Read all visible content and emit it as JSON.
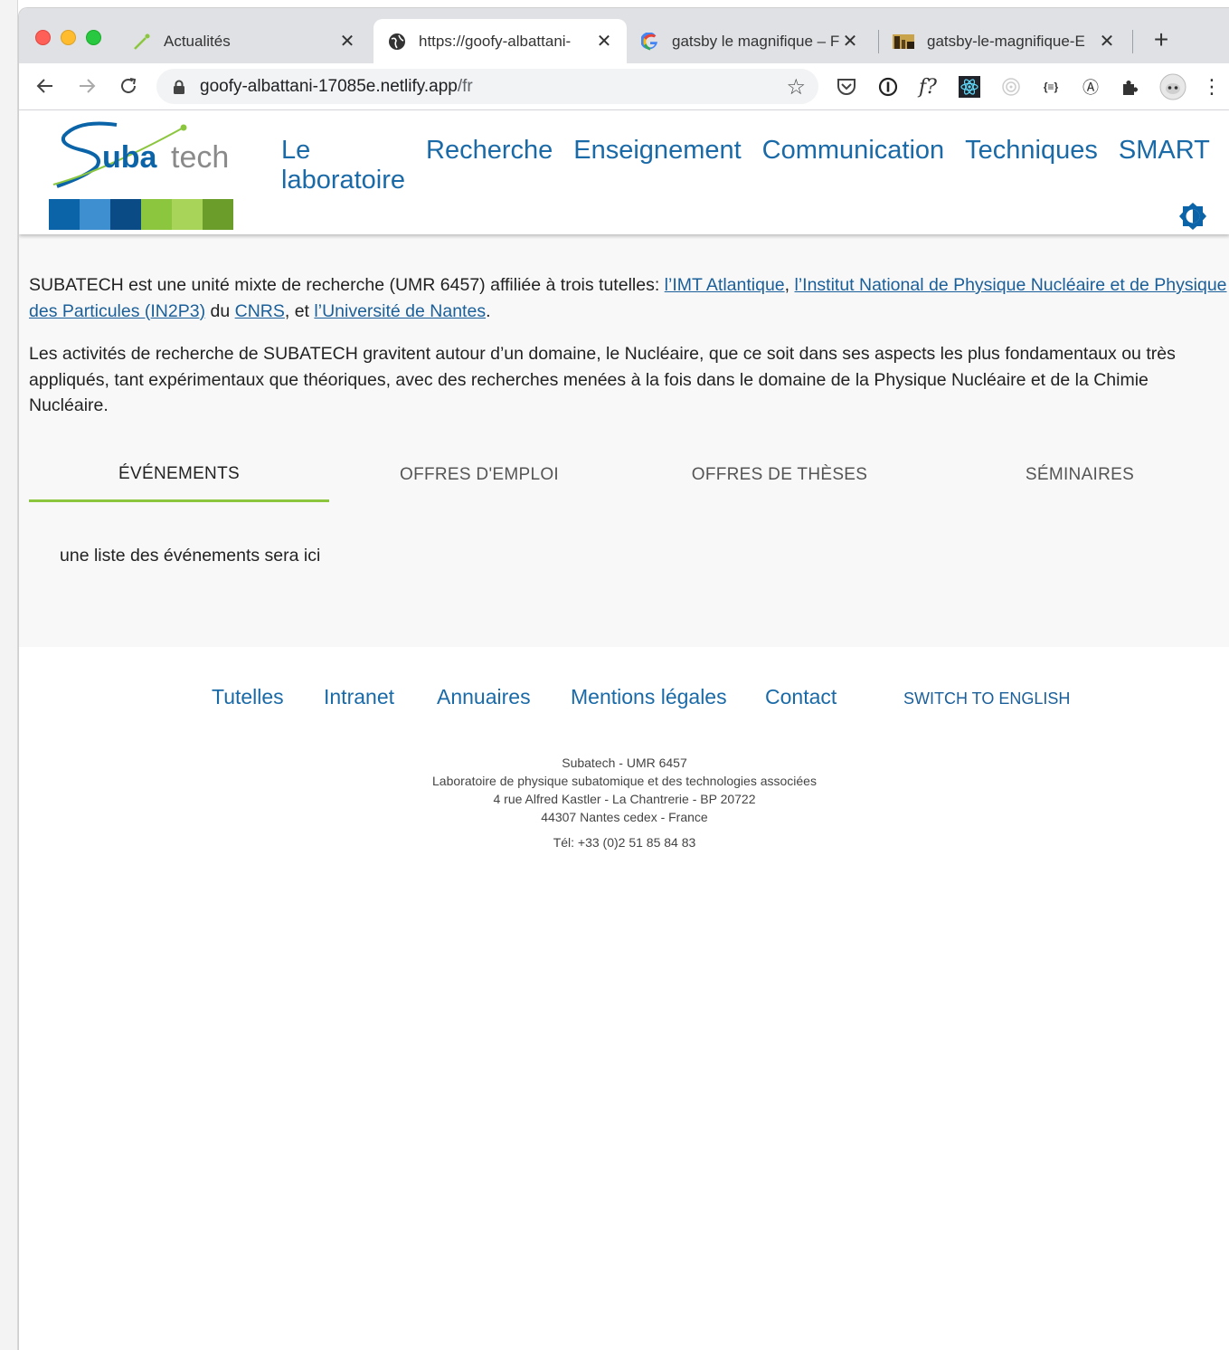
{
  "browser": {
    "tabs": [
      {
        "title": "Actualités",
        "active": false
      },
      {
        "title": "https://goofy-albattani-",
        "active": true
      },
      {
        "title": "gatsby le magnifique – F",
        "active": false
      },
      {
        "title": "gatsby-le-magnifique-E",
        "active": false
      }
    ],
    "new_tab_label": "+",
    "close_glyph": "✕",
    "url_host": "goofy-albattani-17085e.netlify.app",
    "url_path": "/fr",
    "ext_f_label": "f?",
    "ext_braces_label": "{≡}",
    "ext_a_label": "Ⓐ"
  },
  "site": {
    "logo_text_start": "S",
    "logo_text_blue": "uba",
    "logo_text_gray": "tech",
    "color_strip": [
      "#0b64a8",
      "#3d8fd0",
      "#0a4a85",
      "#8cc63f",
      "#a9d45a",
      "#6b9d2a"
    ],
    "nav": [
      "Le laboratoire",
      "Recherche",
      "Enseignement",
      "Communication",
      "Techniques",
      "SMART"
    ],
    "accent": "#1a6aa8"
  },
  "intro": {
    "p1_start": "SUBATECH est une unité mixte de recherche (UMR 6457) affiliée à trois tutelles: ",
    "p1_link1": "l’IMT Atlantique",
    "p1_sep1": ", ",
    "p1_link2": "l’Institut National de Physique Nucléaire et de Physique des Particules (IN2P3)",
    "p1_sep2": " du ",
    "p1_link3": "CNRS",
    "p1_sep3": ", et ",
    "p1_link4": "l’Université de Nantes",
    "p1_end": ".",
    "p2": "Les activités de recherche de SUBATECH gravitent autour d’un domaine, le Nucléaire, que ce soit dans ses aspects les plus fondamentaux ou très appliqués, tant expérimentaux que théoriques, avec des recherches menées à la fois dans le domaine de la Physique Nucléaire et de la Chimie Nucléaire."
  },
  "content_tabs": {
    "items": [
      "ÉVÉNEMENTS",
      "OFFRES D'EMPLOI",
      "OFFRES DE THÈSES",
      "SÉMINAIRES"
    ],
    "active_index": 0,
    "panel_text": "une liste des événements sera ici"
  },
  "footer": {
    "links": [
      "Tutelles",
      "Intranet",
      "Annuaires",
      "Mentions légales",
      "Contact"
    ],
    "switch_lang": "SWITCH TO ENGLISH",
    "address_lines": [
      "Subatech - UMR 6457",
      "Laboratoire de physique subatomique et des technologies associées",
      "4 rue Alfred Kastler - La Chantrerie - BP 20722",
      "44307 Nantes cedex - France"
    ],
    "phone": "Tél: +33 (0)2 51 85 84 83"
  }
}
